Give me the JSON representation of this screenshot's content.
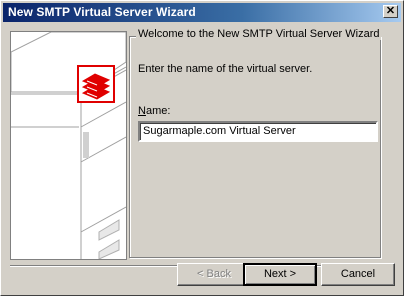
{
  "window": {
    "title": "New SMTP Virtual Server Wizard",
    "close_glyph": "✕"
  },
  "wizard": {
    "group_title": "Welcome to the New SMTP Virtual Server Wizard",
    "instruction": "Enter the name of the virtual server.",
    "name_label_prefix": "N",
    "name_label_rest": "ame:",
    "name_value": "Sugarmaple.com Virtual Server"
  },
  "buttons": {
    "back": "< Back",
    "next": "Next >",
    "cancel": "Cancel"
  },
  "colors": {
    "title_gradient_start": "#0a246a",
    "accent_red": "#e00000",
    "face": "#d4d0c8"
  },
  "icons": {
    "wizard_logo": "mail-envelope-icon"
  }
}
